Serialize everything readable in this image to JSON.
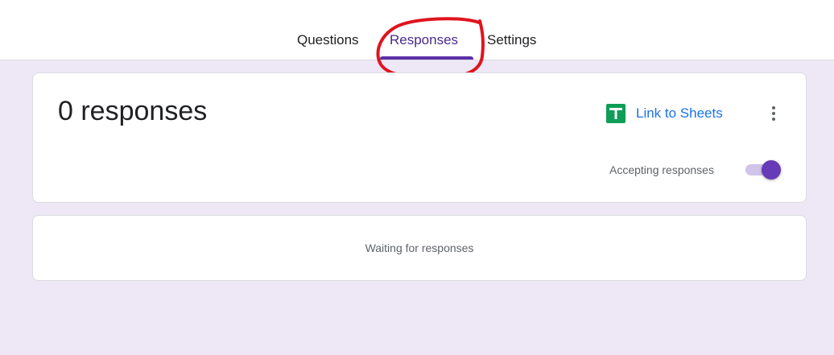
{
  "tabs": [
    {
      "label": "Questions",
      "selected": false
    },
    {
      "label": "Responses",
      "selected": true
    },
    {
      "label": "Settings",
      "selected": false
    }
  ],
  "summary": {
    "count_label": "0 responses",
    "link_sheets_label": "Link to Sheets",
    "accepting_label": "Accepting responses",
    "accepting_enabled": true
  },
  "waiting": {
    "text": "Waiting for responses"
  },
  "icons": {
    "sheets": "google-sheets-icon",
    "more": "more-vert-icon"
  },
  "colors": {
    "page_background": "#ede7f6",
    "accent": "#673ab7",
    "link": "#1a73e8",
    "annotation": "#e0141e"
  }
}
